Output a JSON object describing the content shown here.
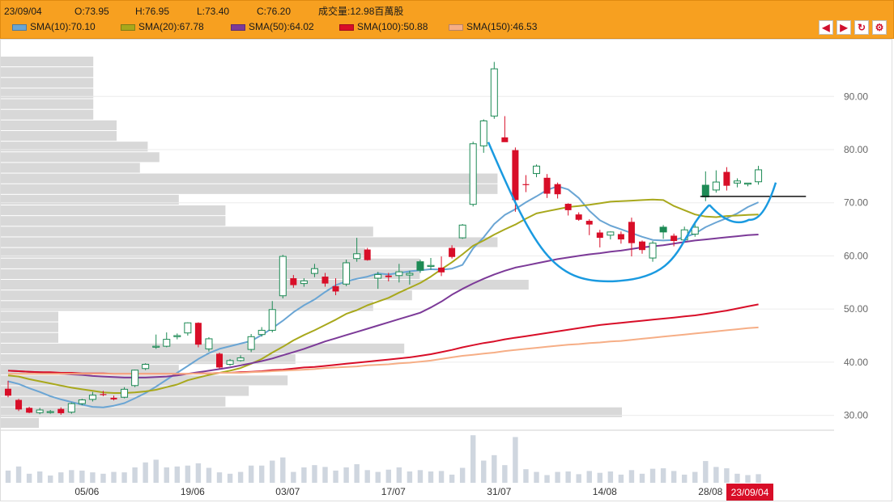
{
  "header": {
    "date": "23/09/04",
    "open": "O:73.95",
    "high": "H:76.95",
    "low": "L:73.40",
    "close": "C:76.20",
    "volume": "成交量:12.98百萬股",
    "legend": [
      {
        "label": "SMA(10):70.10",
        "color": "#6aa5d4"
      },
      {
        "label": "SMA(20):67.78",
        "color": "#a8a81c"
      },
      {
        "label": "SMA(50):64.02",
        "color": "#7c3a98"
      },
      {
        "label": "SMA(100):50.88",
        "color": "#d80e28"
      },
      {
        "label": "SMA(150):46.53",
        "color": "#f6ae86"
      }
    ],
    "tools": [
      {
        "name": "arrow-left-icon",
        "glyph": "◀"
      },
      {
        "name": "arrow-right-icon",
        "glyph": "▶"
      },
      {
        "name": "refresh-icon",
        "glyph": "↻"
      },
      {
        "name": "gear-icon",
        "glyph": "⚙"
      }
    ]
  },
  "chart_data": {
    "type": "candlestick",
    "ylim": [
      27.5,
      97.5
    ],
    "y_ticks": [
      "30.00",
      "40.00",
      "50.00",
      "60.00",
      "70.00",
      "80.00",
      "90.00"
    ],
    "x_ticks": [
      {
        "label": "05/06",
        "index": 7
      },
      {
        "label": "19/06",
        "index": 17
      },
      {
        "label": "03/07",
        "index": 26
      },
      {
        "label": "17/07",
        "index": 36
      },
      {
        "label": "31/07",
        "index": 46
      },
      {
        "label": "14/08",
        "index": 56
      },
      {
        "label": "28/08",
        "index": 66
      }
    ],
    "current_date_label": "23/09/04",
    "up_color": "#1d8a55",
    "down_color": "#d80e28",
    "candles": [
      [
        35.0,
        36.5,
        33.4,
        33.7
      ],
      [
        32.9,
        33.1,
        30.8,
        31.1
      ],
      [
        31.4,
        31.6,
        30.4,
        30.5
      ],
      [
        30.5,
        31.4,
        30.2,
        31.0
      ],
      [
        30.6,
        31.0,
        30.3,
        30.7
      ],
      [
        31.2,
        31.5,
        30.1,
        30.4
      ],
      [
        30.6,
        32.4,
        30.3,
        32.2
      ],
      [
        32.2,
        33.1,
        31.9,
        32.9
      ],
      [
        33.0,
        34.4,
        32.6,
        33.8
      ],
      [
        34.0,
        34.6,
        33.6,
        33.9
      ],
      [
        33.3,
        33.7,
        32.8,
        33.0
      ],
      [
        33.4,
        35.3,
        33.2,
        34.9
      ],
      [
        35.6,
        38.6,
        35.3,
        38.5
      ],
      [
        38.8,
        39.8,
        38.5,
        39.6
      ],
      [
        43.0,
        45.2,
        42.5,
        43.0
      ],
      [
        43.0,
        45.6,
        42.8,
        44.3
      ],
      [
        44.8,
        45.4,
        44.3,
        45.0
      ],
      [
        45.5,
        47.5,
        45.0,
        47.4
      ],
      [
        47.4,
        47.5,
        42.8,
        43.3
      ],
      [
        42.5,
        44.7,
        42.0,
        44.4
      ],
      [
        41.6,
        41.8,
        38.8,
        39.0
      ],
      [
        39.6,
        40.6,
        39.3,
        40.3
      ],
      [
        40.3,
        41.3,
        40.1,
        40.8
      ],
      [
        42.4,
        45.3,
        41.9,
        44.8
      ],
      [
        45.2,
        46.6,
        44.8,
        46.0
      ],
      [
        46.0,
        51.5,
        45.6,
        49.9
      ],
      [
        52.5,
        60.2,
        52.0,
        59.9
      ],
      [
        55.8,
        56.4,
        54.0,
        54.5
      ],
      [
        54.8,
        55.8,
        54.2,
        55.3
      ],
      [
        56.7,
        58.5,
        56.0,
        57.6
      ],
      [
        56.1,
        56.8,
        54.2,
        54.8
      ],
      [
        54.3,
        55.8,
        52.6,
        53.3
      ],
      [
        54.7,
        59.3,
        54.3,
        58.7
      ],
      [
        59.5,
        63.4,
        58.9,
        60.4
      ],
      [
        61.2,
        61.5,
        59.1,
        59.2
      ],
      [
        55.8,
        57.0,
        53.8,
        56.5
      ],
      [
        56.3,
        56.8,
        55.2,
        56.0
      ],
      [
        56.3,
        58.5,
        55.0,
        57.0
      ],
      [
        56.4,
        57.2,
        54.6,
        56.7
      ],
      [
        57.3,
        59.3,
        56.8,
        58.9
      ],
      [
        58.1,
        59.6,
        57.4,
        58.2
      ],
      [
        57.8,
        59.9,
        56.2,
        56.9
      ],
      [
        61.5,
        62.0,
        59.5,
        59.8
      ],
      [
        63.4,
        66.0,
        63.2,
        65.8
      ],
      [
        69.7,
        81.5,
        69.3,
        81.1
      ],
      [
        80.7,
        85.7,
        79.4,
        85.4
      ],
      [
        86.3,
        96.5,
        85.8,
        95.2
      ],
      [
        82.3,
        86.3,
        81.5,
        81.4
      ],
      [
        79.9,
        80.4,
        68.3,
        70.5
      ],
      [
        73.5,
        75.2,
        72.0,
        73.4
      ],
      [
        75.5,
        77.2,
        74.8,
        76.9
      ],
      [
        74.7,
        75.4,
        70.9,
        71.7
      ],
      [
        73.5,
        73.8,
        70.8,
        71.6
      ],
      [
        69.8,
        69.9,
        67.6,
        68.6
      ],
      [
        67.8,
        68.2,
        66.6,
        66.8
      ],
      [
        66.6,
        66.9,
        63.9,
        65.9
      ],
      [
        64.4,
        64.9,
        61.6,
        63.4
      ],
      [
        63.9,
        64.6,
        63.1,
        64.5
      ],
      [
        64.1,
        64.6,
        62.3,
        63.1
      ],
      [
        66.4,
        67.2,
        59.9,
        62.4
      ],
      [
        62.7,
        62.9,
        60.4,
        61.1
      ],
      [
        59.6,
        62.8,
        58.9,
        62.4
      ],
      [
        64.5,
        65.8,
        63.2,
        65.4
      ],
      [
        63.8,
        64.2,
        61.8,
        62.8
      ],
      [
        63.0,
        65.5,
        62.7,
        64.9
      ],
      [
        64.1,
        66.5,
        63.6,
        65.4
      ],
      [
        71.1,
        75.9,
        70.3,
        73.3
      ],
      [
        72.4,
        76.1,
        71.9,
        73.9
      ],
      [
        75.8,
        76.7,
        72.3,
        73.2
      ],
      [
        73.7,
        74.6,
        72.9,
        74.1
      ],
      [
        73.5,
        73.7,
        73.1,
        73.7
      ],
      [
        73.95,
        76.95,
        73.4,
        76.2
      ]
    ],
    "volume": [
      2.7,
      3.6,
      2.0,
      2.5,
      1.6,
      2.3,
      2.8,
      2.7,
      2.3,
      2.0,
      2.4,
      2.3,
      3.4,
      4.5,
      5.1,
      3.4,
      3.6,
      3.8,
      4.3,
      3.3,
      2.3,
      2.0,
      2.4,
      3.8,
      3.8,
      4.9,
      5.6,
      2.4,
      3.4,
      3.9,
      3.5,
      2.7,
      3.4,
      4.1,
      2.8,
      2.4,
      2.9,
      3.4,
      2.5,
      2.8,
      2.5,
      2.6,
      1.8,
      3.3,
      10.5,
      4.9,
      6.1,
      3.9,
      10.1,
      3.0,
      2.4,
      1.7,
      2.4,
      2.5,
      1.9,
      2.6,
      2.2,
      2.5,
      1.8,
      2.8,
      2.0,
      3.1,
      3.2,
      2.6,
      1.8,
      2.4,
      4.8,
      3.5,
      3.2,
      2.0,
      1.7,
      1.9
    ],
    "series": [
      {
        "name": "SMA(10)",
        "color": "#6aa5d4",
        "values": [
          36.4,
          35.9,
          35.1,
          34.4,
          33.6,
          33.0,
          32.5,
          32.0,
          31.6,
          31.5,
          31.8,
          32.3,
          33.2,
          34.2,
          35.4,
          36.7,
          38.0,
          39.3,
          40.6,
          41.7,
          42.5,
          43.0,
          43.5,
          44.0,
          45.1,
          46.4,
          47.8,
          49.4,
          50.7,
          51.8,
          53.2,
          54.5,
          55.2,
          55.7,
          56.1,
          56.7,
          56.5,
          56.8,
          57.1,
          57.3,
          57.5,
          57.4,
          57.6,
          58.3,
          61.4,
          63.5,
          66.0,
          67.7,
          68.8,
          70.1,
          71.2,
          72.4,
          73.1,
          72.5,
          70.9,
          68.5,
          66.7,
          65.7,
          65.0,
          64.3,
          63.6,
          63.0,
          62.9,
          63.0,
          63.5,
          64.2,
          65.4,
          66.3,
          67.1,
          68.0,
          69.2,
          70.1
        ]
      },
      {
        "name": "SMA(20)",
        "color": "#a8a81c",
        "values": [
          37.5,
          37.3,
          36.8,
          36.4,
          36.0,
          35.6,
          35.2,
          34.9,
          34.6,
          34.3,
          34.2,
          34.2,
          34.3,
          34.5,
          34.8,
          35.3,
          35.8,
          36.6,
          37.1,
          37.6,
          38.0,
          38.4,
          38.9,
          39.7,
          40.6,
          41.8,
          42.9,
          44.1,
          45.1,
          46.0,
          47.0,
          48.0,
          49.1,
          49.8,
          50.7,
          51.4,
          52.1,
          53.1,
          54.0,
          54.9,
          56.1,
          57.5,
          58.8,
          60.3,
          61.9,
          62.9,
          64.0,
          65.0,
          65.9,
          67.0,
          68.0,
          68.4,
          68.8,
          69.2,
          69.4,
          69.6,
          69.9,
          70.2,
          70.3,
          70.4,
          70.5,
          70.6,
          70.5,
          69.4,
          68.6,
          67.8,
          67.4,
          67.3,
          67.5,
          67.6,
          67.7,
          67.8
        ]
      },
      {
        "name": "SMA(50)",
        "color": "#7c3a98",
        "values": [
          38.4,
          38.3,
          38.2,
          38.1,
          38.0,
          37.8,
          37.7,
          37.6,
          37.4,
          37.3,
          37.2,
          37.1,
          37.1,
          37.1,
          37.2,
          37.3,
          37.5,
          37.8,
          38.1,
          38.4,
          38.7,
          39.0,
          39.4,
          39.8,
          40.2,
          40.7,
          41.3,
          41.9,
          42.5,
          43.2,
          43.9,
          44.5,
          45.1,
          45.7,
          46.3,
          46.9,
          47.5,
          48.1,
          48.7,
          49.3,
          50.3,
          51.4,
          52.7,
          53.8,
          54.8,
          55.7,
          56.5,
          57.2,
          57.8,
          58.2,
          58.6,
          59.0,
          59.4,
          59.7,
          60.0,
          60.3,
          60.5,
          60.8,
          61.0,
          61.3,
          61.6,
          61.8,
          62.0,
          62.3,
          62.6,
          62.9,
          63.1,
          63.3,
          63.5,
          63.7,
          63.9,
          64.02
        ]
      },
      {
        "name": "SMA(100)",
        "color": "#d80e28",
        "values": [
          38.4,
          38.3,
          38.2,
          38.1,
          38.1,
          38.0,
          38.0,
          37.9,
          37.9,
          37.9,
          37.8,
          37.8,
          37.8,
          37.8,
          37.8,
          37.8,
          37.8,
          37.8,
          37.9,
          37.9,
          38.0,
          38.0,
          38.1,
          38.2,
          38.3,
          38.5,
          38.6,
          38.8,
          39.0,
          39.1,
          39.3,
          39.5,
          39.7,
          39.9,
          40.1,
          40.3,
          40.5,
          40.7,
          40.9,
          41.2,
          41.5,
          41.9,
          42.3,
          42.8,
          43.2,
          43.6,
          43.9,
          44.3,
          44.6,
          44.9,
          45.2,
          45.5,
          45.8,
          46.1,
          46.4,
          46.7,
          47.0,
          47.2,
          47.4,
          47.6,
          47.8,
          48.0,
          48.2,
          48.4,
          48.6,
          48.8,
          49.1,
          49.4,
          49.7,
          50.1,
          50.5,
          50.88
        ]
      },
      {
        "name": "SMA(150)",
        "color": "#f6ae86",
        "values": [
          37.8,
          37.8,
          37.8,
          37.8,
          37.8,
          37.8,
          37.8,
          37.8,
          37.8,
          37.8,
          37.8,
          37.8,
          37.8,
          37.8,
          37.8,
          37.8,
          37.8,
          37.8,
          37.9,
          37.9,
          38.0,
          38.0,
          38.0,
          38.1,
          38.2,
          38.3,
          38.4,
          38.5,
          38.6,
          38.7,
          38.9,
          39.0,
          39.1,
          39.2,
          39.4,
          39.5,
          39.6,
          39.8,
          39.9,
          40.1,
          40.3,
          40.6,
          40.9,
          41.2,
          41.4,
          41.6,
          41.8,
          42.1,
          42.3,
          42.5,
          42.7,
          42.9,
          43.1,
          43.3,
          43.4,
          43.6,
          43.7,
          43.9,
          44.0,
          44.2,
          44.4,
          44.6,
          44.8,
          45.0,
          45.2,
          45.4,
          45.6,
          45.8,
          46.0,
          46.2,
          46.4,
          46.53
        ]
      }
    ],
    "volume_profile": [
      [
        96.5,
        1.2
      ],
      [
        94.5,
        1.2
      ],
      [
        92.5,
        1.2
      ],
      [
        90.5,
        1.2
      ],
      [
        88.5,
        1.2
      ],
      [
        86.5,
        1.2
      ],
      [
        84.5,
        1.5
      ],
      [
        82.5,
        1.5
      ],
      [
        80.5,
        1.9
      ],
      [
        78.5,
        2.05
      ],
      [
        76.5,
        1.8
      ],
      [
        74.5,
        6.4
      ],
      [
        72.5,
        6.4
      ],
      [
        70.5,
        2.3
      ],
      [
        68.5,
        2.9
      ],
      [
        66.5,
        2.9
      ],
      [
        64.5,
        4.8
      ],
      [
        62.5,
        6.4
      ],
      [
        60.5,
        4.7
      ],
      [
        58.5,
        5.4
      ],
      [
        56.5,
        5.4
      ],
      [
        54.5,
        6.8
      ],
      [
        52.5,
        5.3
      ],
      [
        50.5,
        4.8
      ],
      [
        48.5,
        0.75
      ],
      [
        46.5,
        0.75
      ],
      [
        44.5,
        0.75
      ],
      [
        42.5,
        5.2
      ],
      [
        40.5,
        3.8
      ],
      [
        38.5,
        2.3
      ],
      [
        36.5,
        3.7
      ],
      [
        34.5,
        3.2
      ],
      [
        32.5,
        2.9
      ],
      [
        30.5,
        8.0
      ],
      [
        28.5,
        0.5
      ]
    ],
    "annotations": [
      {
        "type": "cup",
        "color": "#1a9ae0",
        "points": [
          [
            60.5,
            81.4
          ],
          [
            68,
            61
          ],
          [
            75.9,
            55.3
          ],
          [
            83.5,
            60
          ],
          [
            89.9,
            69.6
          ],
          [
            93.5,
            67.8
          ],
          [
            96.8,
            66.8
          ],
          [
            99.4,
            73.8
          ]
        ]
      },
      {
        "type": "handle",
        "color": "#1a9ae0",
        "points": [
          [
            89.9,
            69.6
          ],
          [
            93.5,
            67.8
          ],
          [
            96.8,
            66.8
          ],
          [
            99.4,
            73.8
          ]
        ]
      },
      {
        "type": "horizontal",
        "color": "#111111",
        "y": 71.2,
        "x0": 85.5,
        "x1": 95.5
      }
    ]
  }
}
